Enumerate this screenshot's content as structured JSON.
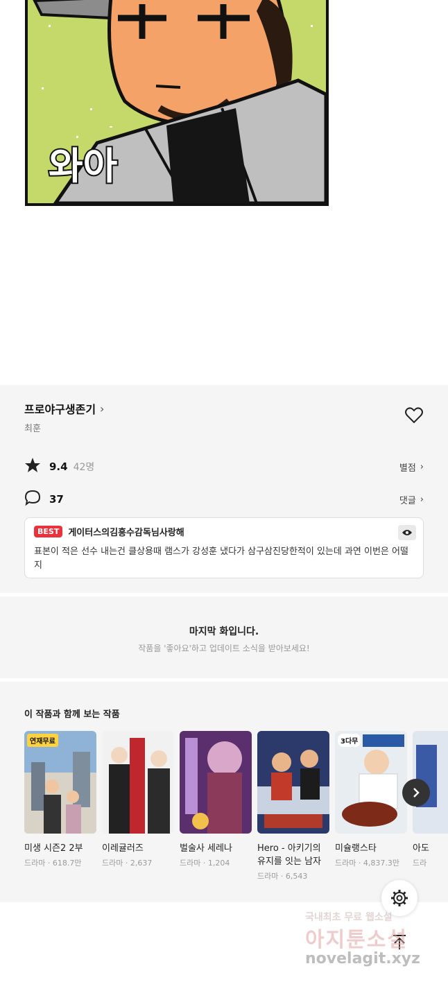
{
  "comic": {
    "sound_effect": "와아"
  },
  "work": {
    "title": "프로야구생존기",
    "author": "최훈",
    "rating": "9.4",
    "rating_count": "42명",
    "rating_link": "별점",
    "comment_count": "37",
    "comment_link": "댓글"
  },
  "best_comment": {
    "badge": "BEST",
    "user": "게이터스의김흥수감독님사랑해",
    "text": "표본이 적은 선수 내는건 클상용때 램스가 강성훈 냈다가 삼구삼진당한적이 있는데 과연 이번은 어떨지"
  },
  "last_episode": {
    "title": "마지막 화입니다.",
    "subtitle": "작품을 '좋아요'하고 업데이트 소식을 받아보세요!"
  },
  "recommendations": {
    "heading": "이 작품과 함께 보는 작품",
    "items": [
      {
        "badge": "연재무료",
        "name": "미생 시즌2 2부",
        "meta": "드라마 · 618.7만",
        "colors": [
          "#8fb3d6",
          "#d9d2c6"
        ]
      },
      {
        "name": "이레귤러즈",
        "meta": "드라마 · 2,637",
        "colors": [
          "#f1f1f1",
          "#c0262d"
        ]
      },
      {
        "name": "벌술사 세레나",
        "meta": "드라마 · 1,204",
        "colors": [
          "#5b2e6e",
          "#d8a7c9"
        ]
      },
      {
        "name": "Hero - 아키기의 유지를 잇는 남자",
        "meta": "드라마 · 6,543",
        "colors": [
          "#2b3a6a",
          "#c23a2a"
        ]
      },
      {
        "badge": "3다무",
        "name": "미슐랭스타",
        "meta": "드라마 · 4,837.3만",
        "colors": [
          "#e8edf2",
          "#7d2a18"
        ]
      },
      {
        "name": "아도",
        "meta": "드라",
        "colors": [
          "#dfe6ef",
          "#3b5aa6"
        ]
      }
    ]
  },
  "watermark": {
    "line1": "국내최초 무료 웹소설",
    "line2": "아지툰소설",
    "line3": "novelagit.xyz"
  }
}
